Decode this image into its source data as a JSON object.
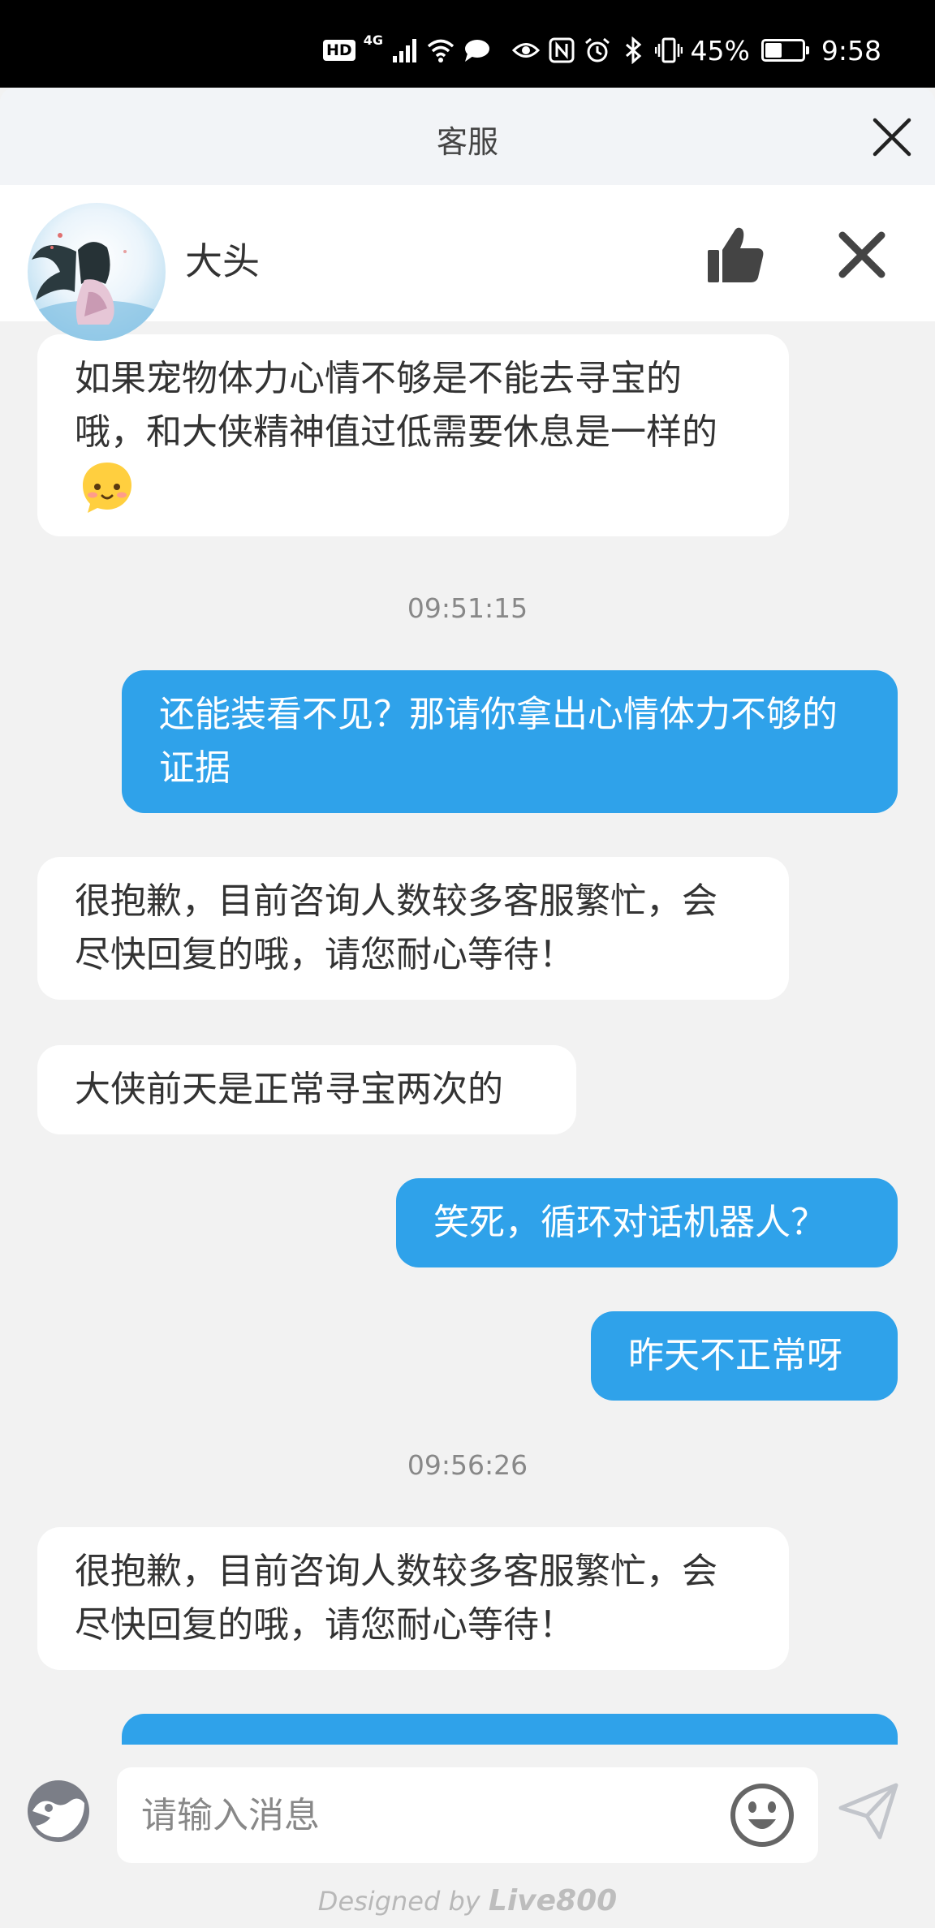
{
  "status_bar": {
    "hd": "HD",
    "network": "4G",
    "battery_percent": "45%",
    "battery_level": 0.45,
    "time": "9:58",
    "icons": [
      "signal-icon",
      "wifi-icon",
      "message-icon",
      "eye-icon",
      "nfc-icon",
      "alarm-icon",
      "bluetooth-icon",
      "vibrate-icon",
      "battery-icon"
    ]
  },
  "titlebar": {
    "title": "客服"
  },
  "agent": {
    "name": "大头"
  },
  "colors": {
    "user_bubble": "#2fa2ea",
    "agent_bubble": "#ffffff",
    "background": "#f2f2f2"
  },
  "messages": [
    {
      "sender": "agent",
      "text": "如果宠物体力心情不够是不能去寻宝的哦，和大侠精神值过低需要休息是一样的",
      "emoji": "shy-smile-emoji"
    },
    {
      "type": "timestamp",
      "text": "09:51:15"
    },
    {
      "sender": "user",
      "text": "还能装看不见？那请你拿出心情体力不够的证据"
    },
    {
      "sender": "agent",
      "text": "很抱歉，目前咨询人数较多客服繁忙，会尽快回复的哦，请您耐心等待！"
    },
    {
      "sender": "agent",
      "text": "大侠前天是正常寻宝两次的"
    },
    {
      "sender": "user",
      "text": "笑死，循环对话机器人？"
    },
    {
      "sender": "user",
      "text": "昨天不正常呀"
    },
    {
      "type": "timestamp",
      "text": "09:56:26"
    },
    {
      "sender": "agent",
      "text": "很抱歉，目前咨询人数较多客服繁忙，会尽快回复的哦，请您耐心等待！"
    }
  ],
  "input": {
    "placeholder": "请输入消息",
    "value": ""
  },
  "footer": {
    "prefix": "Designed by",
    "brand": "Live800"
  }
}
